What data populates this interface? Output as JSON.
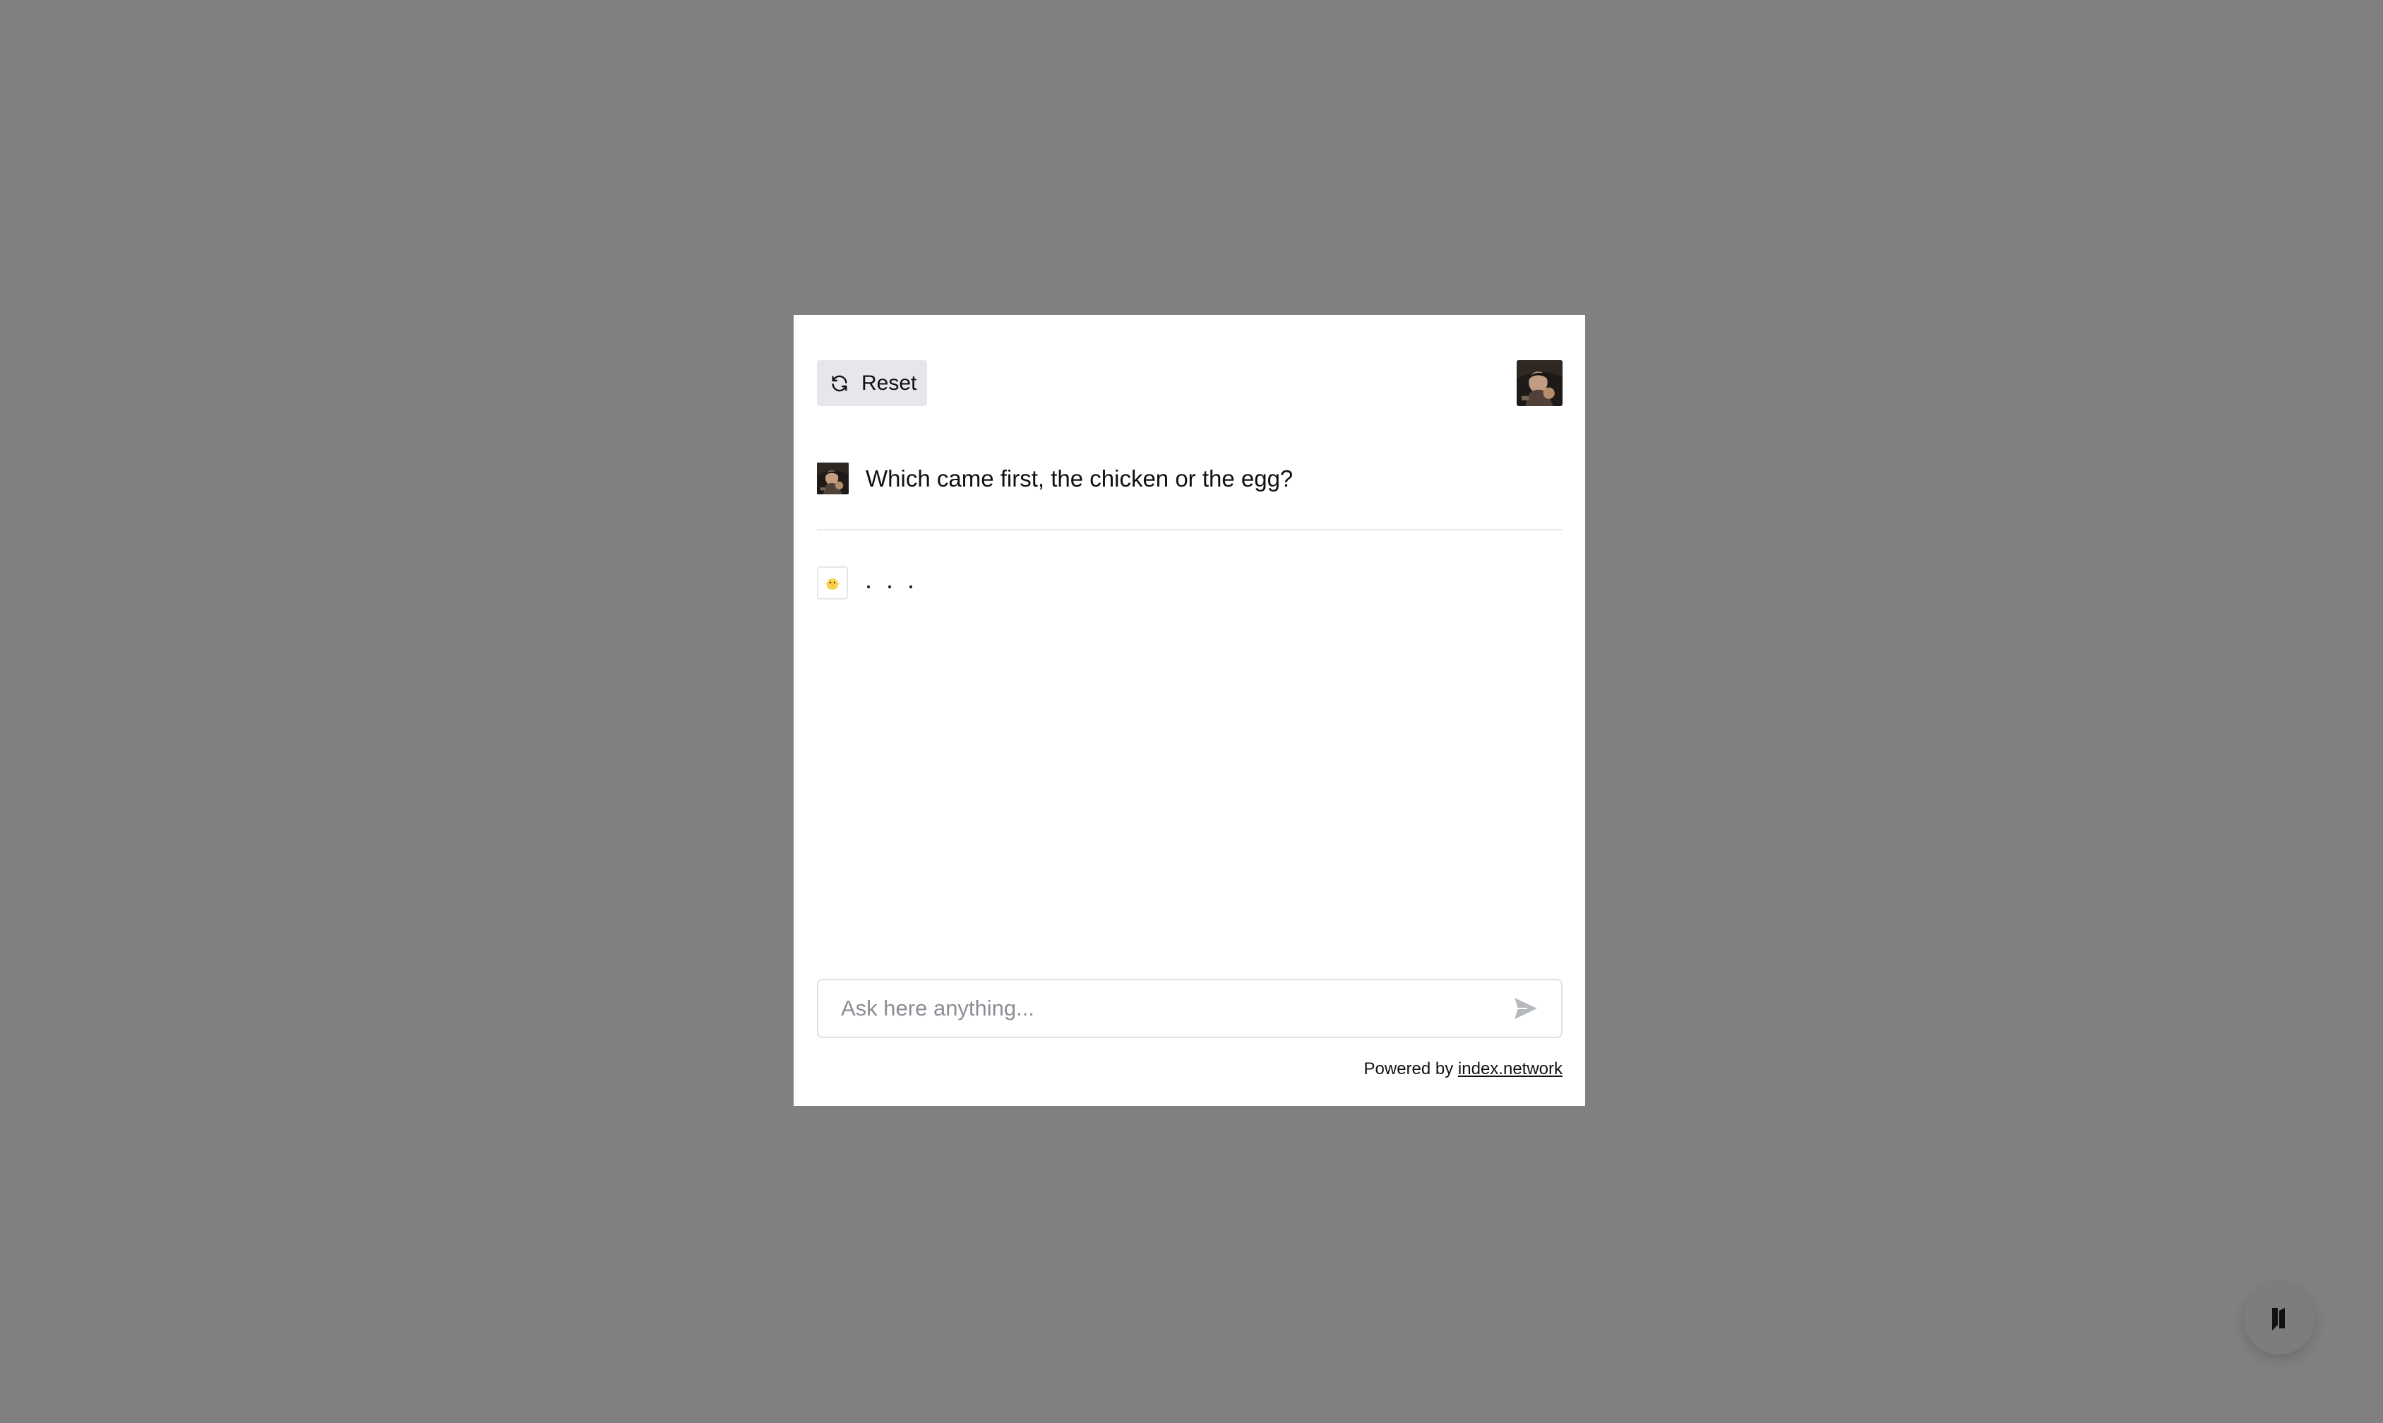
{
  "colors": {
    "backdrop": "#808080",
    "modal_background": "#ffffff",
    "reset_button_background": "#e5e7eb",
    "divider": "#e5e7eb",
    "placeholder": "#8b8e94",
    "send_icon": "#b5b8bd"
  },
  "header": {
    "reset_label": "Reset",
    "reset_icon": "refresh-icon",
    "avatar": "user-avatar"
  },
  "conversation": {
    "user_message": {
      "avatar": "user-avatar",
      "text": "Which came first, the chicken or the egg?"
    },
    "assistant_message": {
      "avatar": "chick-emoji-avatar",
      "text": ". . ."
    }
  },
  "composer": {
    "placeholder": "Ask here anything...",
    "value": "",
    "send_icon": "send-icon"
  },
  "footer": {
    "powered_by_prefix": "Powered by",
    "powered_by_link": "index.network"
  },
  "launcher": {
    "icon": "index-network-logo-icon"
  }
}
